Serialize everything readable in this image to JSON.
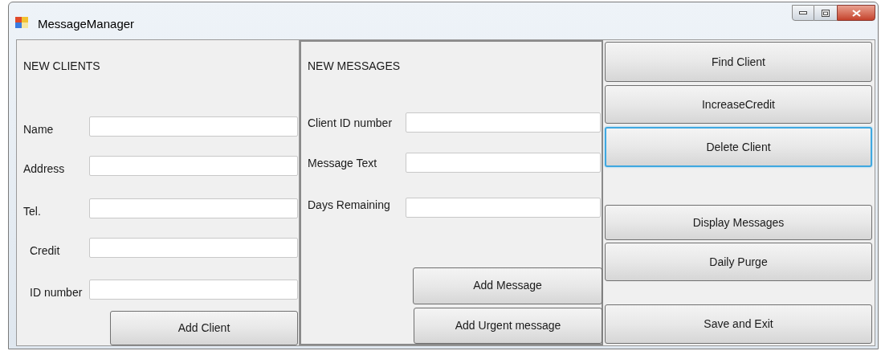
{
  "window": {
    "title": "MessageManager"
  },
  "new_clients": {
    "heading": "NEW CLIENTS",
    "fields": [
      {
        "label": "Name"
      },
      {
        "label": "Address"
      },
      {
        "label": "Tel."
      },
      {
        "label": "Credit"
      },
      {
        "label": "ID number"
      }
    ],
    "button": "Add Client"
  },
  "new_messages": {
    "heading": "NEW MESSAGES",
    "fields": [
      {
        "label": "Client ID number"
      },
      {
        "label": "Message Text"
      },
      {
        "label": "Days Remaining"
      }
    ],
    "buttons": [
      "Add Message",
      "Add Urgent message"
    ]
  },
  "actions": [
    {
      "label": "Find Client",
      "focused": false
    },
    {
      "label": "IncreaseCredit",
      "focused": false
    },
    {
      "label": "Delete Client",
      "focused": true
    },
    {
      "label": "Display Messages",
      "focused": false
    },
    {
      "label": "Daily Purge",
      "focused": false
    },
    {
      "label": "Save and Exit",
      "focused": false
    }
  ]
}
